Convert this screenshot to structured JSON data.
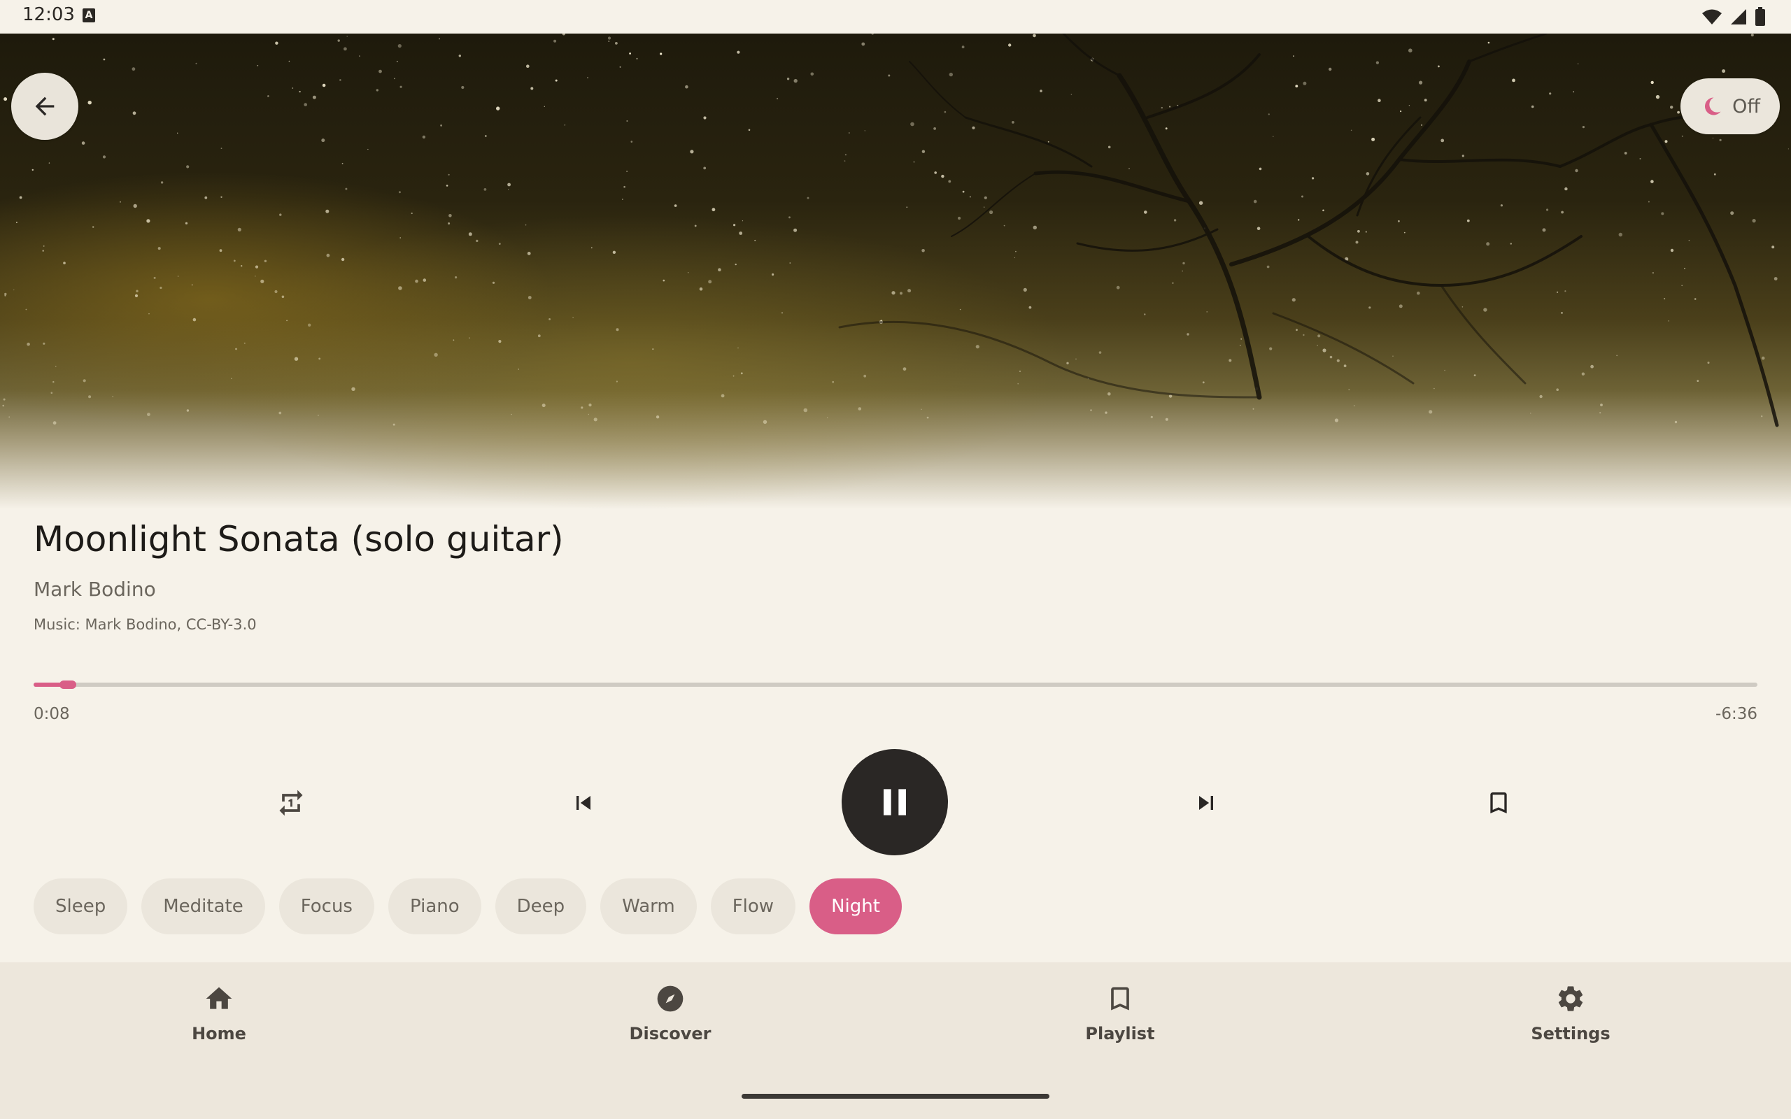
{
  "status_bar": {
    "time": "12:03",
    "badge": "A"
  },
  "colors": {
    "accent": "#d95e87",
    "background": "#f6f2e9",
    "nav_background": "#ede7dc",
    "play_button": "#2a2725"
  },
  "header": {
    "back_icon": "arrow-back-icon",
    "sleep_timer": {
      "icon": "moon-icon",
      "label": "Off"
    }
  },
  "track": {
    "title": "Moonlight Sonata (solo guitar)",
    "artist": "Mark Bodino",
    "credit": "Music: Mark Bodino, CC-BY-3.0"
  },
  "progress": {
    "elapsed": "0:08",
    "remaining": "-6:36",
    "fraction": 0.02
  },
  "controls": {
    "repeat_icon": "repeat-one-icon",
    "previous_icon": "skip-previous-icon",
    "play_pause_icon": "pause-icon",
    "next_icon": "skip-next-icon",
    "bookmark_icon": "bookmark-icon"
  },
  "tags": [
    "Sleep",
    "Meditate",
    "Focus",
    "Piano",
    "Deep",
    "Warm",
    "Flow",
    "Night"
  ],
  "active_tag": "Night",
  "nav": {
    "items": [
      {
        "label": "Home",
        "icon": "home-icon"
      },
      {
        "label": "Discover",
        "icon": "compass-icon"
      },
      {
        "label": "Playlist",
        "icon": "bookmark-icon"
      },
      {
        "label": "Settings",
        "icon": "gear-icon"
      }
    ]
  }
}
